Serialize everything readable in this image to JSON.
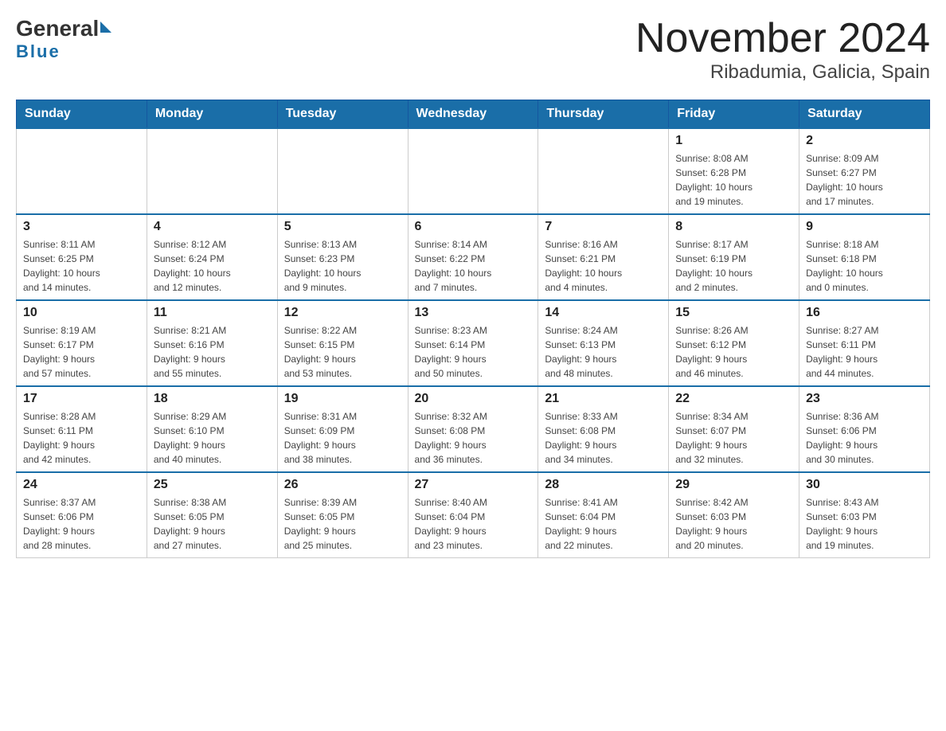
{
  "header": {
    "logo_general": "General",
    "logo_blue": "Blue",
    "month_year": "November 2024",
    "location": "Ribadumia, Galicia, Spain"
  },
  "days_of_week": [
    "Sunday",
    "Monday",
    "Tuesday",
    "Wednesday",
    "Thursday",
    "Friday",
    "Saturday"
  ],
  "weeks": [
    [
      {
        "day": "",
        "info": ""
      },
      {
        "day": "",
        "info": ""
      },
      {
        "day": "",
        "info": ""
      },
      {
        "day": "",
        "info": ""
      },
      {
        "day": "",
        "info": ""
      },
      {
        "day": "1",
        "info": "Sunrise: 8:08 AM\nSunset: 6:28 PM\nDaylight: 10 hours\nand 19 minutes."
      },
      {
        "day": "2",
        "info": "Sunrise: 8:09 AM\nSunset: 6:27 PM\nDaylight: 10 hours\nand 17 minutes."
      }
    ],
    [
      {
        "day": "3",
        "info": "Sunrise: 8:11 AM\nSunset: 6:25 PM\nDaylight: 10 hours\nand 14 minutes."
      },
      {
        "day": "4",
        "info": "Sunrise: 8:12 AM\nSunset: 6:24 PM\nDaylight: 10 hours\nand 12 minutes."
      },
      {
        "day": "5",
        "info": "Sunrise: 8:13 AM\nSunset: 6:23 PM\nDaylight: 10 hours\nand 9 minutes."
      },
      {
        "day": "6",
        "info": "Sunrise: 8:14 AM\nSunset: 6:22 PM\nDaylight: 10 hours\nand 7 minutes."
      },
      {
        "day": "7",
        "info": "Sunrise: 8:16 AM\nSunset: 6:21 PM\nDaylight: 10 hours\nand 4 minutes."
      },
      {
        "day": "8",
        "info": "Sunrise: 8:17 AM\nSunset: 6:19 PM\nDaylight: 10 hours\nand 2 minutes."
      },
      {
        "day": "9",
        "info": "Sunrise: 8:18 AM\nSunset: 6:18 PM\nDaylight: 10 hours\nand 0 minutes."
      }
    ],
    [
      {
        "day": "10",
        "info": "Sunrise: 8:19 AM\nSunset: 6:17 PM\nDaylight: 9 hours\nand 57 minutes."
      },
      {
        "day": "11",
        "info": "Sunrise: 8:21 AM\nSunset: 6:16 PM\nDaylight: 9 hours\nand 55 minutes."
      },
      {
        "day": "12",
        "info": "Sunrise: 8:22 AM\nSunset: 6:15 PM\nDaylight: 9 hours\nand 53 minutes."
      },
      {
        "day": "13",
        "info": "Sunrise: 8:23 AM\nSunset: 6:14 PM\nDaylight: 9 hours\nand 50 minutes."
      },
      {
        "day": "14",
        "info": "Sunrise: 8:24 AM\nSunset: 6:13 PM\nDaylight: 9 hours\nand 48 minutes."
      },
      {
        "day": "15",
        "info": "Sunrise: 8:26 AM\nSunset: 6:12 PM\nDaylight: 9 hours\nand 46 minutes."
      },
      {
        "day": "16",
        "info": "Sunrise: 8:27 AM\nSunset: 6:11 PM\nDaylight: 9 hours\nand 44 minutes."
      }
    ],
    [
      {
        "day": "17",
        "info": "Sunrise: 8:28 AM\nSunset: 6:11 PM\nDaylight: 9 hours\nand 42 minutes."
      },
      {
        "day": "18",
        "info": "Sunrise: 8:29 AM\nSunset: 6:10 PM\nDaylight: 9 hours\nand 40 minutes."
      },
      {
        "day": "19",
        "info": "Sunrise: 8:31 AM\nSunset: 6:09 PM\nDaylight: 9 hours\nand 38 minutes."
      },
      {
        "day": "20",
        "info": "Sunrise: 8:32 AM\nSunset: 6:08 PM\nDaylight: 9 hours\nand 36 minutes."
      },
      {
        "day": "21",
        "info": "Sunrise: 8:33 AM\nSunset: 6:08 PM\nDaylight: 9 hours\nand 34 minutes."
      },
      {
        "day": "22",
        "info": "Sunrise: 8:34 AM\nSunset: 6:07 PM\nDaylight: 9 hours\nand 32 minutes."
      },
      {
        "day": "23",
        "info": "Sunrise: 8:36 AM\nSunset: 6:06 PM\nDaylight: 9 hours\nand 30 minutes."
      }
    ],
    [
      {
        "day": "24",
        "info": "Sunrise: 8:37 AM\nSunset: 6:06 PM\nDaylight: 9 hours\nand 28 minutes."
      },
      {
        "day": "25",
        "info": "Sunrise: 8:38 AM\nSunset: 6:05 PM\nDaylight: 9 hours\nand 27 minutes."
      },
      {
        "day": "26",
        "info": "Sunrise: 8:39 AM\nSunset: 6:05 PM\nDaylight: 9 hours\nand 25 minutes."
      },
      {
        "day": "27",
        "info": "Sunrise: 8:40 AM\nSunset: 6:04 PM\nDaylight: 9 hours\nand 23 minutes."
      },
      {
        "day": "28",
        "info": "Sunrise: 8:41 AM\nSunset: 6:04 PM\nDaylight: 9 hours\nand 22 minutes."
      },
      {
        "day": "29",
        "info": "Sunrise: 8:42 AM\nSunset: 6:03 PM\nDaylight: 9 hours\nand 20 minutes."
      },
      {
        "day": "30",
        "info": "Sunrise: 8:43 AM\nSunset: 6:03 PM\nDaylight: 9 hours\nand 19 minutes."
      }
    ]
  ]
}
